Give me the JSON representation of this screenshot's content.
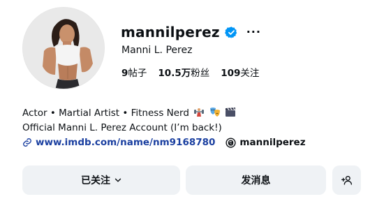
{
  "profile": {
    "username": "mannilperez",
    "full_name": "Manni L. Perez",
    "verified": true,
    "more_label": "···"
  },
  "stats": {
    "posts_value": "9",
    "posts_label": "帖子",
    "followers_value": "10.5万",
    "followers_label": "粉丝",
    "following_value": "109",
    "following_label": "关注"
  },
  "bio": {
    "line1": "Actor • Martial Artist • Fitness Nerd",
    "line2": "Official Manni L. Perez Account (I’m back!)",
    "emojis": [
      "weight-lifter-emoji",
      "theater-masks-emoji",
      "clapper-board-emoji"
    ]
  },
  "links": {
    "website": "www.imdb.com/name/nm9168780",
    "threads": "mannilperez"
  },
  "actions": {
    "following_label": "已关注",
    "message_label": "发消息"
  },
  "colors": {
    "verified_blue": "#0095f6",
    "link_blue": "#1a3fa0",
    "button_bg": "#eff2f5"
  }
}
